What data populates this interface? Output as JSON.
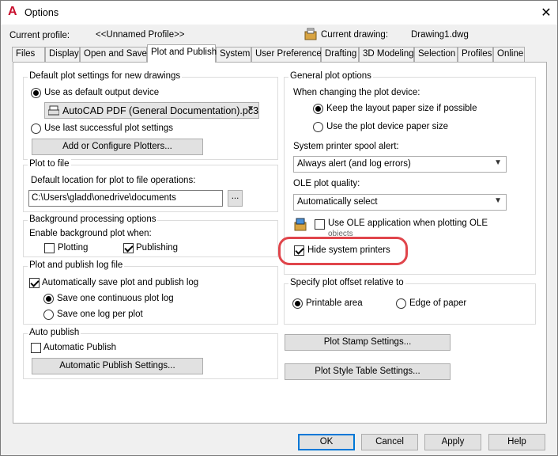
{
  "window": {
    "title": "Options",
    "close_label": "✕",
    "logo_letter": "A"
  },
  "profile": {
    "current_profile_label": "Current profile:",
    "current_profile_value": "<<Unnamed Profile>>",
    "current_drawing_label": "Current drawing:",
    "current_drawing_value": "Drawing1.dwg"
  },
  "tabs": [
    "Files",
    "Display",
    "Open and Save",
    "Plot and Publish",
    "System",
    "User Preferences",
    "Drafting",
    "3D Modeling",
    "Selection",
    "Profiles",
    "Online"
  ],
  "active_tab": "Plot and Publish",
  "default_plot": {
    "title": "Default plot settings for new drawings",
    "use_default_label": "Use as default output device",
    "device_value": "AutoCAD PDF (General Documentation).pc3",
    "use_last_label": "Use last successful plot settings",
    "add_plotters_label": "Add or Configure Plotters..."
  },
  "plot_to_file": {
    "title": "Plot to file",
    "location_label": "Default location for plot to file operations:",
    "location_value": "C:\\Users\\gladd\\onedrive\\documents",
    "browse_label": "..."
  },
  "background": {
    "title": "Background processing options",
    "enable_label": "Enable background plot when:",
    "plotting_label": "Plotting",
    "publishing_label": "Publishing"
  },
  "log": {
    "title": "Plot and publish log file",
    "auto_save_label": "Automatically save plot and publish log",
    "continuous_label": "Save one continuous plot log",
    "per_plot_label": "Save one log per plot"
  },
  "auto_publish": {
    "title": "Auto publish",
    "auto_publish_label": "Automatic Publish",
    "settings_label": "Automatic Publish Settings..."
  },
  "general": {
    "title": "General plot options",
    "changing_label": "When changing the plot device:",
    "keep_layout_label": "Keep the layout paper size if possible",
    "use_device_label": "Use the plot device paper size",
    "spool_label": "System printer spool alert:",
    "spool_value": "Always alert (and log errors)",
    "ole_quality_label": "OLE plot quality:",
    "ole_quality_value": "Automatically select",
    "use_ole_label": "Use OLE application when plotting OLE",
    "use_ole_label_2": "objects",
    "hide_printers_label": "Hide system printers"
  },
  "offset": {
    "title": "Specify plot offset relative to",
    "printable_label": "Printable area",
    "edge_label": "Edge of paper"
  },
  "plot_stamp_label": "Plot Stamp Settings...",
  "plot_style_label": "Plot Style Table Settings...",
  "footer": {
    "ok": "OK",
    "cancel": "Cancel",
    "apply": "Apply",
    "help": "Help"
  },
  "colors": {
    "highlight": "#e0454b",
    "accent": "#0078d7",
    "logo": "#c8102e"
  }
}
